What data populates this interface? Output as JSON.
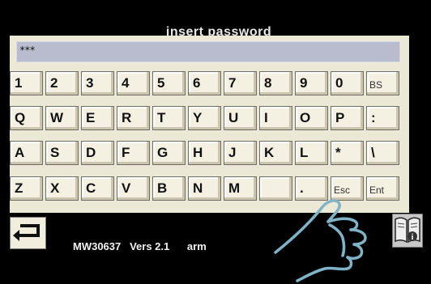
{
  "header": {
    "title": "insert password"
  },
  "password_field": {
    "value": "***"
  },
  "keyboard": {
    "rows": [
      [
        "1",
        "2",
        "3",
        "4",
        "5",
        "6",
        "7",
        "8",
        "9",
        "0",
        "BS"
      ],
      [
        "Q",
        "W",
        "E",
        "R",
        "T",
        "Y",
        "U",
        "I",
        "O",
        "P",
        ":"
      ],
      [
        "A",
        "S",
        "D",
        "F",
        "G",
        "H",
        "J",
        "K",
        "L",
        "*",
        "\\"
      ],
      [
        "Z",
        "X",
        "C",
        "V",
        "B",
        "N",
        "M",
        "",
        ".",
        "Esc",
        "Ent"
      ]
    ]
  },
  "footer": {
    "model": "MW30637",
    "version": "Vers 2.1",
    "platform": "arm"
  },
  "icons": {
    "back": "back-arrow-icon",
    "manual": "info-book-icon",
    "pointer": "pointing-hand-icon"
  },
  "colors": {
    "panel": "#ece8d6",
    "key": "#f4f1e2",
    "field": "#b9bcce",
    "hand": "#7fb3c8"
  }
}
